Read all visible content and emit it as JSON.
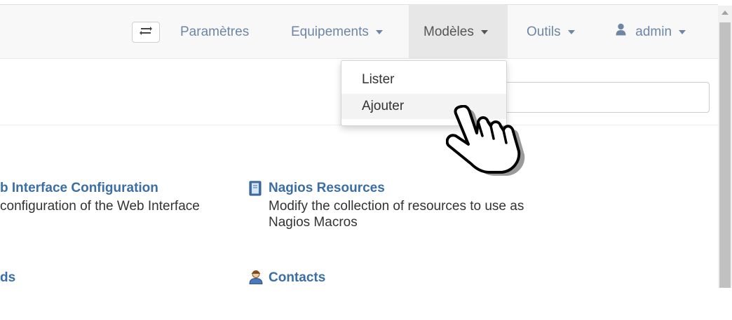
{
  "navbar": {
    "items": [
      {
        "label": "Paramètres"
      },
      {
        "label": "Equipements"
      },
      {
        "label": "Modèles"
      },
      {
        "label": "Outils"
      },
      {
        "label": "admin"
      }
    ]
  },
  "dropdown": {
    "items": [
      {
        "label": "Lister"
      },
      {
        "label": "Ajouter"
      }
    ]
  },
  "cards": [
    {
      "title": "b Interface Configuration",
      "description": "configuration of the Web Interface",
      "icon": "none"
    },
    {
      "title": "Nagios Resources",
      "description": "Modify the collection of resources to use as Nagios Macros",
      "icon": "book-icon"
    },
    {
      "title": "ds",
      "description": "",
      "icon": "none"
    },
    {
      "title": "Contacts",
      "description": "",
      "icon": "contacts-icon"
    }
  ],
  "colors": {
    "link": "#6d86a6",
    "card_title": "#3a6ea5",
    "active_nav_bg": "#e7e7e7",
    "navbar_bg": "#f8f8f8"
  }
}
